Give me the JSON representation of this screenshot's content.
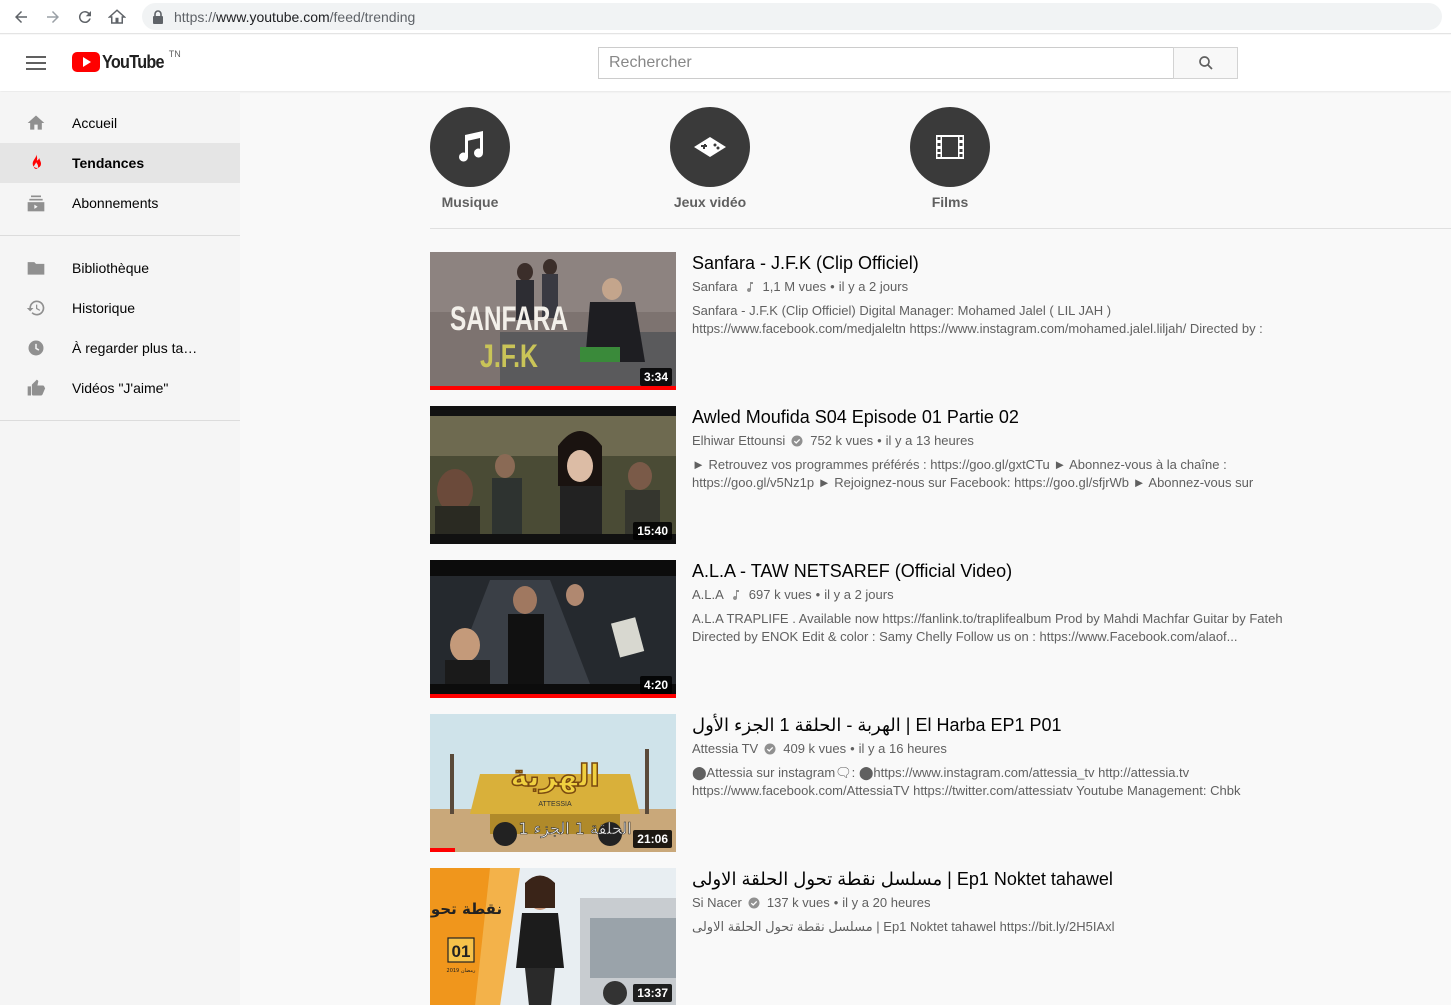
{
  "browser": {
    "url_prefix": "https://",
    "url_host": "www.youtube.com",
    "url_path": "/feed/trending"
  },
  "header": {
    "logo_text": "YouTube",
    "country_code": "TN",
    "search_placeholder": "Rechercher"
  },
  "sidebar": {
    "items": [
      {
        "label": "Accueil",
        "icon": "home-icon"
      },
      {
        "label": "Tendances",
        "icon": "flame-icon",
        "active": true
      },
      {
        "label": "Abonnements",
        "icon": "subscriptions-icon"
      }
    ],
    "library": [
      {
        "label": "Bibliothèque",
        "icon": "folder-icon"
      },
      {
        "label": "Historique",
        "icon": "history-icon"
      },
      {
        "label": "À regarder plus ta…",
        "icon": "clock-icon"
      },
      {
        "label": "Vidéos \"J'aime\"",
        "icon": "thumbs-up-icon"
      }
    ]
  },
  "categories": [
    {
      "label": "Musique",
      "icon": "music-note-icon"
    },
    {
      "label": "Jeux vidéo",
      "icon": "gamepad-icon"
    },
    {
      "label": "Films",
      "icon": "film-icon"
    }
  ],
  "videos": [
    {
      "title": "Sanfara - J.F.K (Clip Officiel)",
      "channel": "Sanfara",
      "badge": "music-note-icon",
      "views": "1,1 M vues",
      "age": "il y a 2 jours",
      "desc1": "Sanfara - J.F.K (Clip Officiel) Digital Manager: Mohamed Jalel ( LIL JAH )",
      "desc2": "https://www.facebook.com/medjaleltn https://www.instagram.com/mohamed.jalel.liljah/ Directed by :",
      "duration": "3:34",
      "watched": 1.0,
      "thumb_text1": "SANFARA",
      "thumb_text2": "J.F.K"
    },
    {
      "title": "Awled Moufida S04 Episode 01 Partie 02",
      "channel": "Elhiwar Ettounsi",
      "badge": "verified-icon",
      "views": "752 k vues",
      "age": "il y a 13 heures",
      "desc1": "► Retrouvez vos programmes préférés : https://goo.gl/gxtCTu ► Abonnez-vous à la chaîne :",
      "desc2": "https://goo.gl/v5Nz1p ► Rejoignez-nous sur Facebook: https://goo.gl/sfjrWb ► Abonnez-vous sur",
      "duration": "15:40",
      "watched": 0
    },
    {
      "title": "A.L.A - TAW NETSAREF (Official Video)",
      "channel": "A.L.A",
      "badge": "music-note-icon",
      "views": "697 k vues",
      "age": "il y a 2 jours",
      "desc1": "A.L.A TRAPLIFE . Available now https://fanlink.to/traplifealbum Prod by Mahdi Machfar Guitar by Fateh",
      "desc2": "Directed by ENOK Edit & color : Samy Chelly Follow us on : https://www.Facebook.com/alaof...",
      "duration": "4:20",
      "watched": 1.0
    },
    {
      "title": "الهربة - الحلقة 1 الجزء الأول | El Harba EP1 P01",
      "channel": "Attessia TV",
      "badge": "verified-icon",
      "views": "409 k vues",
      "age": "il y a 16 heures",
      "desc1": "⬤Attessia sur instagram🗨: ⬤https://www.instagram.com/attessia_tv http://attessia.tv",
      "desc2": "https://www.facebook.com/AttessiaTV https://twitter.com/attessiatv Youtube Management: Chbk",
      "duration": "21:06",
      "watched": 0.1,
      "thumb_text1": "الهربة",
      "thumb_text2": "الحلقة 1 الجزء 1",
      "thumb_text3": "ATTESSIA"
    },
    {
      "title": "مسلسل نقطة تحول الحلقة الاولى | Ep1 Noktet tahawel",
      "channel": "Si Nacer",
      "badge": "verified-icon",
      "views": "137 k vues",
      "age": "il y a 20 heures",
      "desc1": "مسلسل نقطة تحول الحلقة الاولى | Ep1 Noktet tahawel https://bit.ly/2H5IAxl",
      "desc2": "",
      "duration": "13:37",
      "watched": 0,
      "thumb_text1": "نقطة تحول",
      "thumb_text2": "01",
      "thumb_text3": "رمضان 2019"
    }
  ],
  "colors": {
    "brand_red": "#ff0000",
    "sidebar_bg": "#f5f5f5",
    "active_bg": "#e5e5e5",
    "category_circle": "#3a3a3a"
  }
}
